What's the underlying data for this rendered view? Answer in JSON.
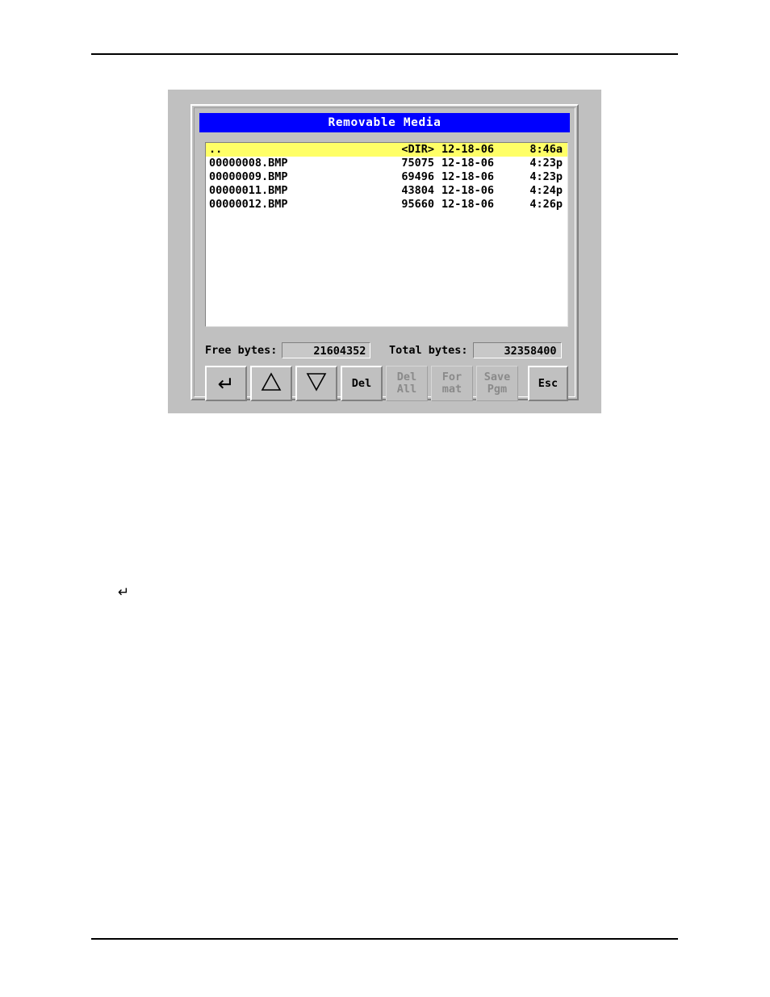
{
  "page": {
    "background": "#ffffff",
    "rule_color": "#000000",
    "body_glyph": "↵"
  },
  "dialog": {
    "title": "Removable Media",
    "title_bar_color": "#0000ff",
    "title_text_color": "#ffffff",
    "panel_color": "#c0c0c0",
    "selection_color": "#ffff66",
    "list_background": "#ffffff",
    "columns": [
      "name",
      "size",
      "date",
      "time"
    ],
    "files": [
      {
        "name": "..",
        "size": "<DIR>",
        "date": "12-18-06",
        "time": "8:46a",
        "selected": true
      },
      {
        "name": "00000008.BMP",
        "size": "75075",
        "date": "12-18-06",
        "time": "4:23p",
        "selected": false
      },
      {
        "name": "00000009.BMP",
        "size": "69496",
        "date": "12-18-06",
        "time": "4:23p",
        "selected": false
      },
      {
        "name": "00000011.BMP",
        "size": "43804",
        "date": "12-18-06",
        "time": "4:24p",
        "selected": false
      },
      {
        "name": "00000012.BMP",
        "size": "95660",
        "date": "12-18-06",
        "time": "4:26p",
        "selected": false
      }
    ],
    "status": {
      "free_label": "Free bytes:",
      "free_value": "21604352",
      "total_label": "Total bytes:",
      "total_value": "32358400"
    },
    "buttons": [
      {
        "id": "enter",
        "icon": "enter-arrow-icon",
        "line1": "",
        "line2": "",
        "enabled": true,
        "type": "glyph"
      },
      {
        "id": "up",
        "icon": "triangle-up-icon",
        "line1": "",
        "line2": "",
        "enabled": true,
        "type": "glyph"
      },
      {
        "id": "down",
        "icon": "triangle-down-icon",
        "line1": "",
        "line2": "",
        "enabled": true,
        "type": "glyph"
      },
      {
        "id": "del",
        "icon": "",
        "line1": "Del",
        "line2": "",
        "enabled": true,
        "type": "text"
      },
      {
        "id": "del-all",
        "icon": "",
        "line1": "Del",
        "line2": "All",
        "enabled": false,
        "type": "text"
      },
      {
        "id": "format",
        "icon": "",
        "line1": "For",
        "line2": "mat",
        "enabled": false,
        "type": "text"
      },
      {
        "id": "save-pgm",
        "icon": "",
        "line1": "Save",
        "line2": "Pgm",
        "enabled": false,
        "type": "text"
      },
      {
        "id": "esc",
        "icon": "",
        "line1": "Esc",
        "line2": "",
        "enabled": true,
        "type": "text"
      }
    ]
  }
}
